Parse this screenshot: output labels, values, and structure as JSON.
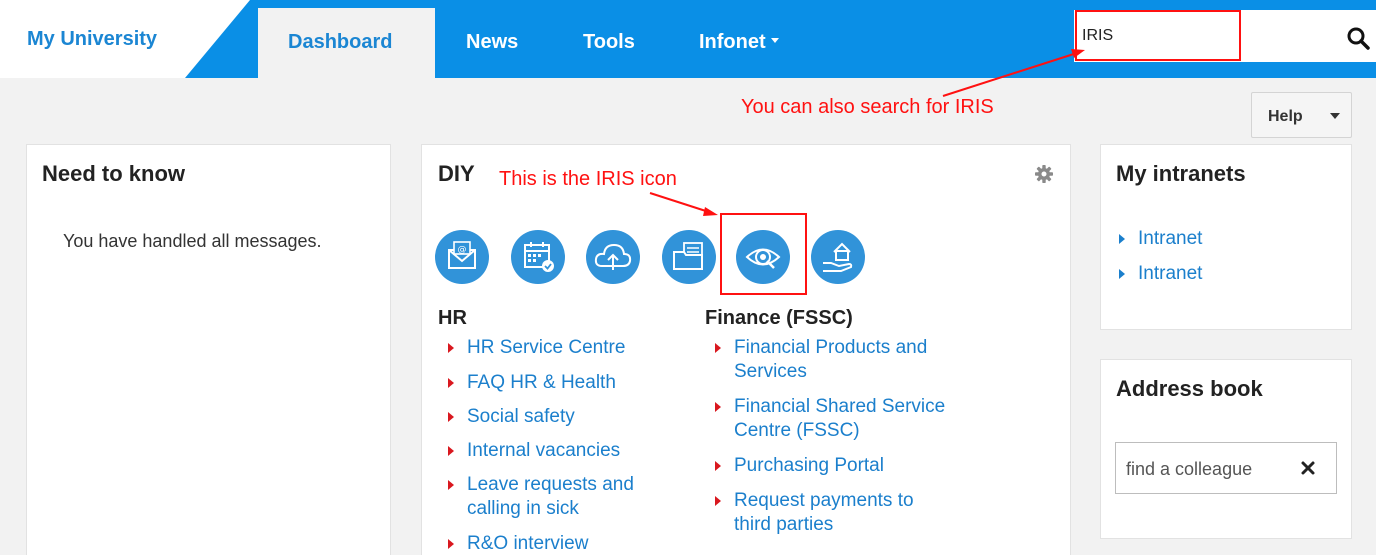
{
  "brand": {
    "name": "My University"
  },
  "nav": {
    "tabs": [
      {
        "label": "Dashboard"
      },
      {
        "label": "News"
      },
      {
        "label": "Tools"
      },
      {
        "label": "Infonet"
      }
    ]
  },
  "search": {
    "value": "IRIS"
  },
  "annotations": {
    "search_note": "You can also search for IRIS",
    "icon_note": "This is the IRIS icon"
  },
  "help": {
    "label": "Help"
  },
  "need_to_know": {
    "title": "Need to know",
    "message": "You have handled all messages."
  },
  "diy": {
    "title": "DIY",
    "icons": [
      "email-icon",
      "calendar-icon",
      "cloud-upload-icon",
      "folder-icon",
      "iris-eye-icon",
      "home-hand-icon"
    ],
    "hr": {
      "heading": "HR",
      "items": [
        "HR Service Centre",
        "FAQ HR & Health",
        "Social safety",
        "Internal vacancies",
        "Leave requests and calling in sick",
        "R&O interview"
      ]
    },
    "finance": {
      "heading": "Finance (FSSC)",
      "items": [
        "Financial Products and Services",
        "Financial Shared Service Centre (FSSC)",
        "Purchasing Portal",
        "Request payments to third parties"
      ]
    }
  },
  "intranets": {
    "title": "My intranets",
    "items": [
      "Intranet",
      "Intranet"
    ]
  },
  "address_book": {
    "title": "Address book",
    "placeholder": "find a colleague"
  },
  "colors": {
    "brand_blue": "#0a8fe6",
    "link_blue": "#1b7fcc",
    "annotation_red": "#ff1111",
    "bullet_red": "#d9181f"
  }
}
